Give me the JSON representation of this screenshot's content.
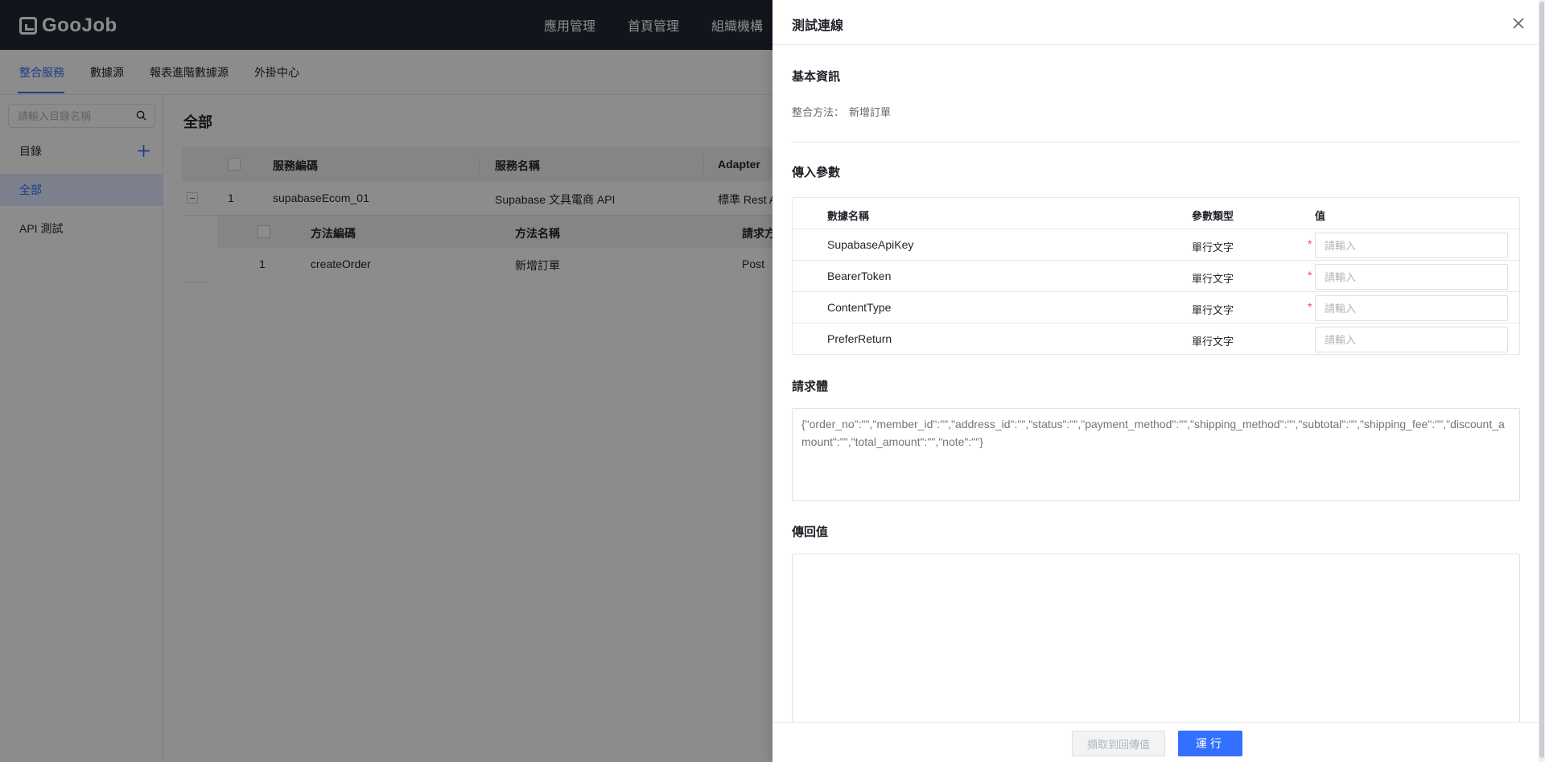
{
  "app": {
    "logo_text": "GooJob"
  },
  "topnav": {
    "items": [
      "應用管理",
      "首頁管理",
      "組織機構"
    ]
  },
  "subnav": {
    "tabs": [
      "整合服務",
      "數據源",
      "報表進階數據源",
      "外掛中心"
    ],
    "active_index": 0
  },
  "sidebar": {
    "search_placeholder": "請輸入目錄名稱",
    "catalog_label": "目錄",
    "items": [
      {
        "label": "全部",
        "active": true
      },
      {
        "label": "API 測試",
        "active": false
      }
    ]
  },
  "main": {
    "title": "全部",
    "columns": [
      "服務編碼",
      "服務名稱",
      "Adapter"
    ],
    "rows": [
      {
        "index": "1",
        "code": "supabaseEcom_01",
        "name": "Supabase 文具電商 API",
        "adapter": "標準 Rest A"
      }
    ],
    "sub_columns": [
      "方法編碼",
      "方法名稱",
      "請求方"
    ],
    "sub_rows": [
      {
        "index": "1",
        "code": "createOrder",
        "name": "新增訂單",
        "method": "Post"
      }
    ]
  },
  "drawer": {
    "title": "測試連線",
    "basic_info_title": "基本資訊",
    "method_label": "整合方法：",
    "method_value": "新增訂單",
    "params_title": "傳入參數",
    "param_columns": [
      "數據名稱",
      "參數類型",
      "值"
    ],
    "input_placeholder": "請輸入",
    "params": [
      {
        "name": "SupabaseApiKey",
        "type": "單行文字",
        "required": true
      },
      {
        "name": "BearerToken",
        "type": "單行文字",
        "required": true
      },
      {
        "name": "ContentType",
        "type": "單行文字",
        "required": true
      },
      {
        "name": "PreferReturn",
        "type": "單行文字",
        "required": false
      }
    ],
    "request_body_title": "請求體",
    "request_body_placeholder": "{\"order_no\":\"\",\"member_id\":\"\",\"address_id\":\"\",\"status\":\"\",\"payment_method\":\"\",\"shipping_method\":\"\",\"subtotal\":\"\",\"shipping_fee\":\"\",\"discount_amount\":\"\",\"total_amount\":\"\",\"note\":\"\"}",
    "return_title": "傳回值",
    "fetch_button": "擷取到回傳值",
    "run_button": "運行"
  },
  "colors": {
    "primary": "#3370ff",
    "topbar": "#222834",
    "required": "#f54a45"
  }
}
